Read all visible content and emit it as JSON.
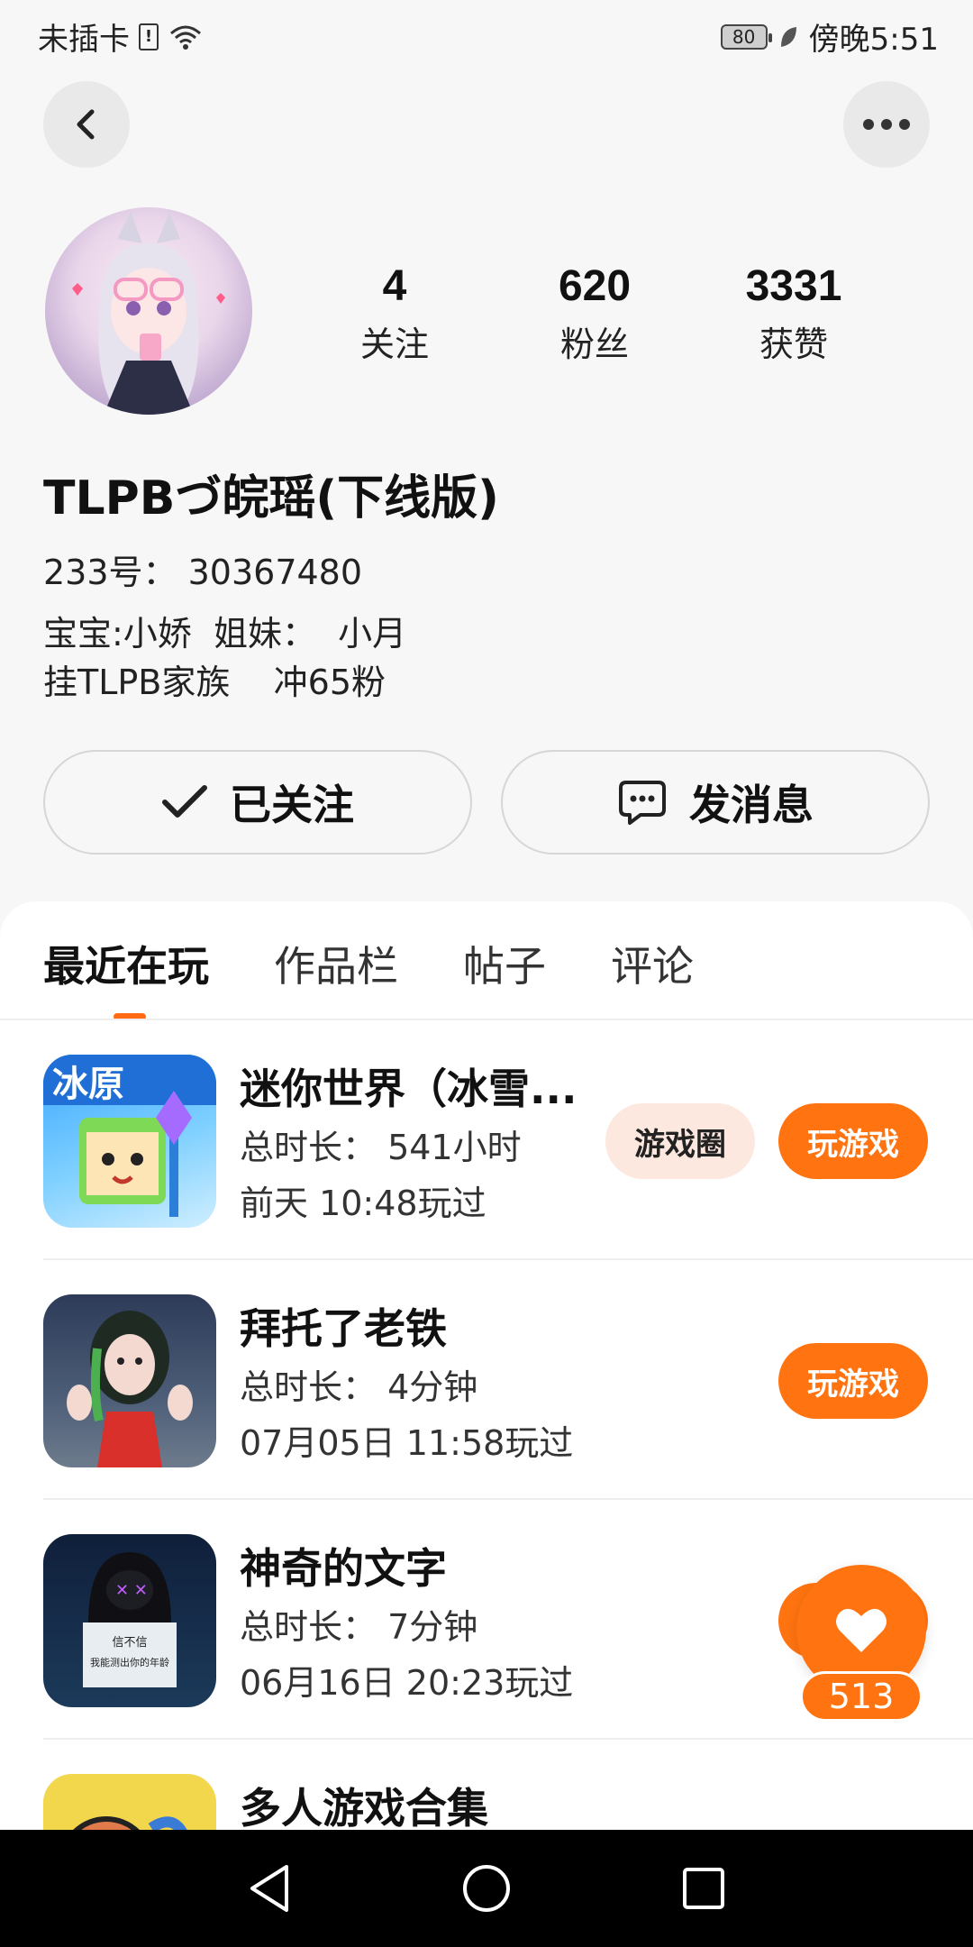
{
  "status_bar": {
    "carrier": "未插卡",
    "battery": "80",
    "time": "傍晚5:51"
  },
  "profile": {
    "stats": [
      {
        "value": "4",
        "label": "关注"
      },
      {
        "value": "620",
        "label": "粉丝"
      },
      {
        "value": "3331",
        "label": "获赞"
      }
    ],
    "name": "TLPBづ皖瑶(下线版)",
    "id_line": "233号：  30367480",
    "bio_line1": "宝宝:小娇  姐妹：  小月",
    "bio_line2": "挂TLPB家族    冲65粉",
    "follow_label": "已关注",
    "message_label": "发消息"
  },
  "tabs": [
    {
      "label": "最近在玩",
      "active": true
    },
    {
      "label": "作品栏",
      "active": false
    },
    {
      "label": "帖子",
      "active": false
    },
    {
      "label": "评论",
      "active": false
    }
  ],
  "games": [
    {
      "title": "迷你世界（冰雪...",
      "duration": "总时长：  541小时",
      "last_played": "前天 10:48玩过",
      "circle_label": "游戏圈",
      "play_label": "玩游戏"
    },
    {
      "title": "拜托了老铁",
      "duration": "总时长：  4分钟",
      "last_played": "07月05日 11:58玩过",
      "play_label": "玩游戏"
    },
    {
      "title": "神奇的文字",
      "duration": "总时长：  7分钟",
      "last_played": "06月16日 20:23玩过"
    },
    {
      "title": "多人游戏合集"
    }
  ],
  "game_icon_text": {
    "g1_badge": "冰原",
    "g3_line1": "信不信",
    "g3_line2": "我能测出你的年龄"
  },
  "like_fab": {
    "count": "513"
  },
  "colors": {
    "accent": "#ff7410",
    "peach": "#fde8df"
  }
}
